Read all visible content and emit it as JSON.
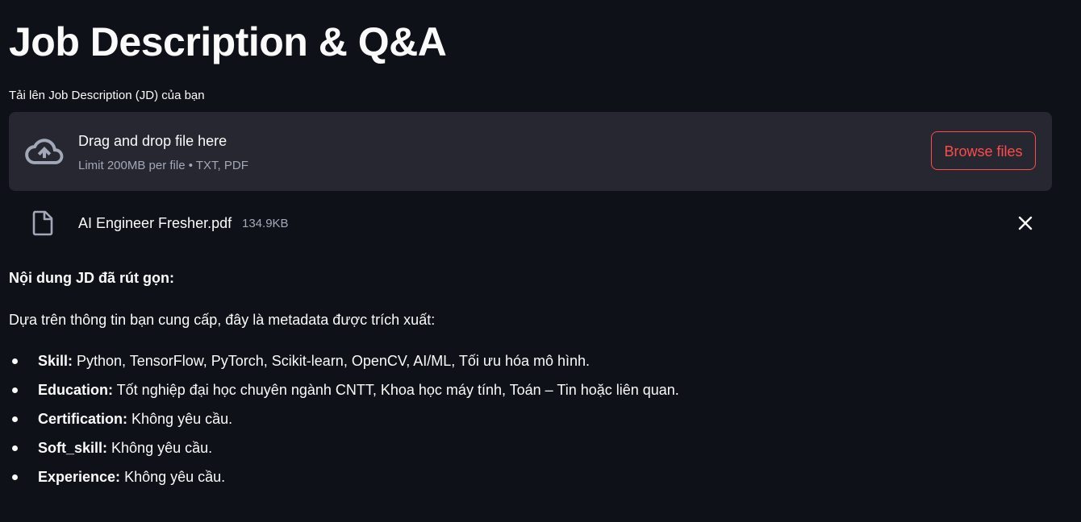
{
  "page": {
    "title": "Job Description & Q&A"
  },
  "uploader": {
    "label": "Tải lên Job Description (JD) của bạn",
    "drop_title": "Drag and drop file here",
    "limit_text": "Limit 200MB per file • TXT, PDF",
    "browse_label": "Browse files",
    "icon": "cloud-upload-icon"
  },
  "uploaded_file": {
    "name": "AI Engineer Fresher.pdf",
    "size": "134.9KB",
    "icon": "file-icon",
    "remove_icon": "close-icon"
  },
  "summary": {
    "heading": "Nội dung JD đã rút gọn:",
    "intro": "Dựa trên thông tin bạn cung cấp, đây là metadata được trích xuất:",
    "items": [
      {
        "key": "Skill:",
        "value": " Python, TensorFlow, PyTorch, Scikit-learn, OpenCV, AI/ML, Tối ưu hóa mô hình."
      },
      {
        "key": "Education:",
        "value": " Tốt nghiệp đại học chuyên ngành CNTT, Khoa học máy tính, Toán – Tin hoặc liên quan."
      },
      {
        "key": "Certification:",
        "value": " Không yêu cầu."
      },
      {
        "key": "Soft_skill:",
        "value": " Không yêu cầu."
      },
      {
        "key": "Experience:",
        "value": " Không yêu cầu."
      }
    ]
  },
  "colors": {
    "background": "#0e1117",
    "panel": "#262730",
    "accent": "#ff4b4b",
    "muted_text": "#a3a8b8",
    "text": "#fafafa"
  }
}
